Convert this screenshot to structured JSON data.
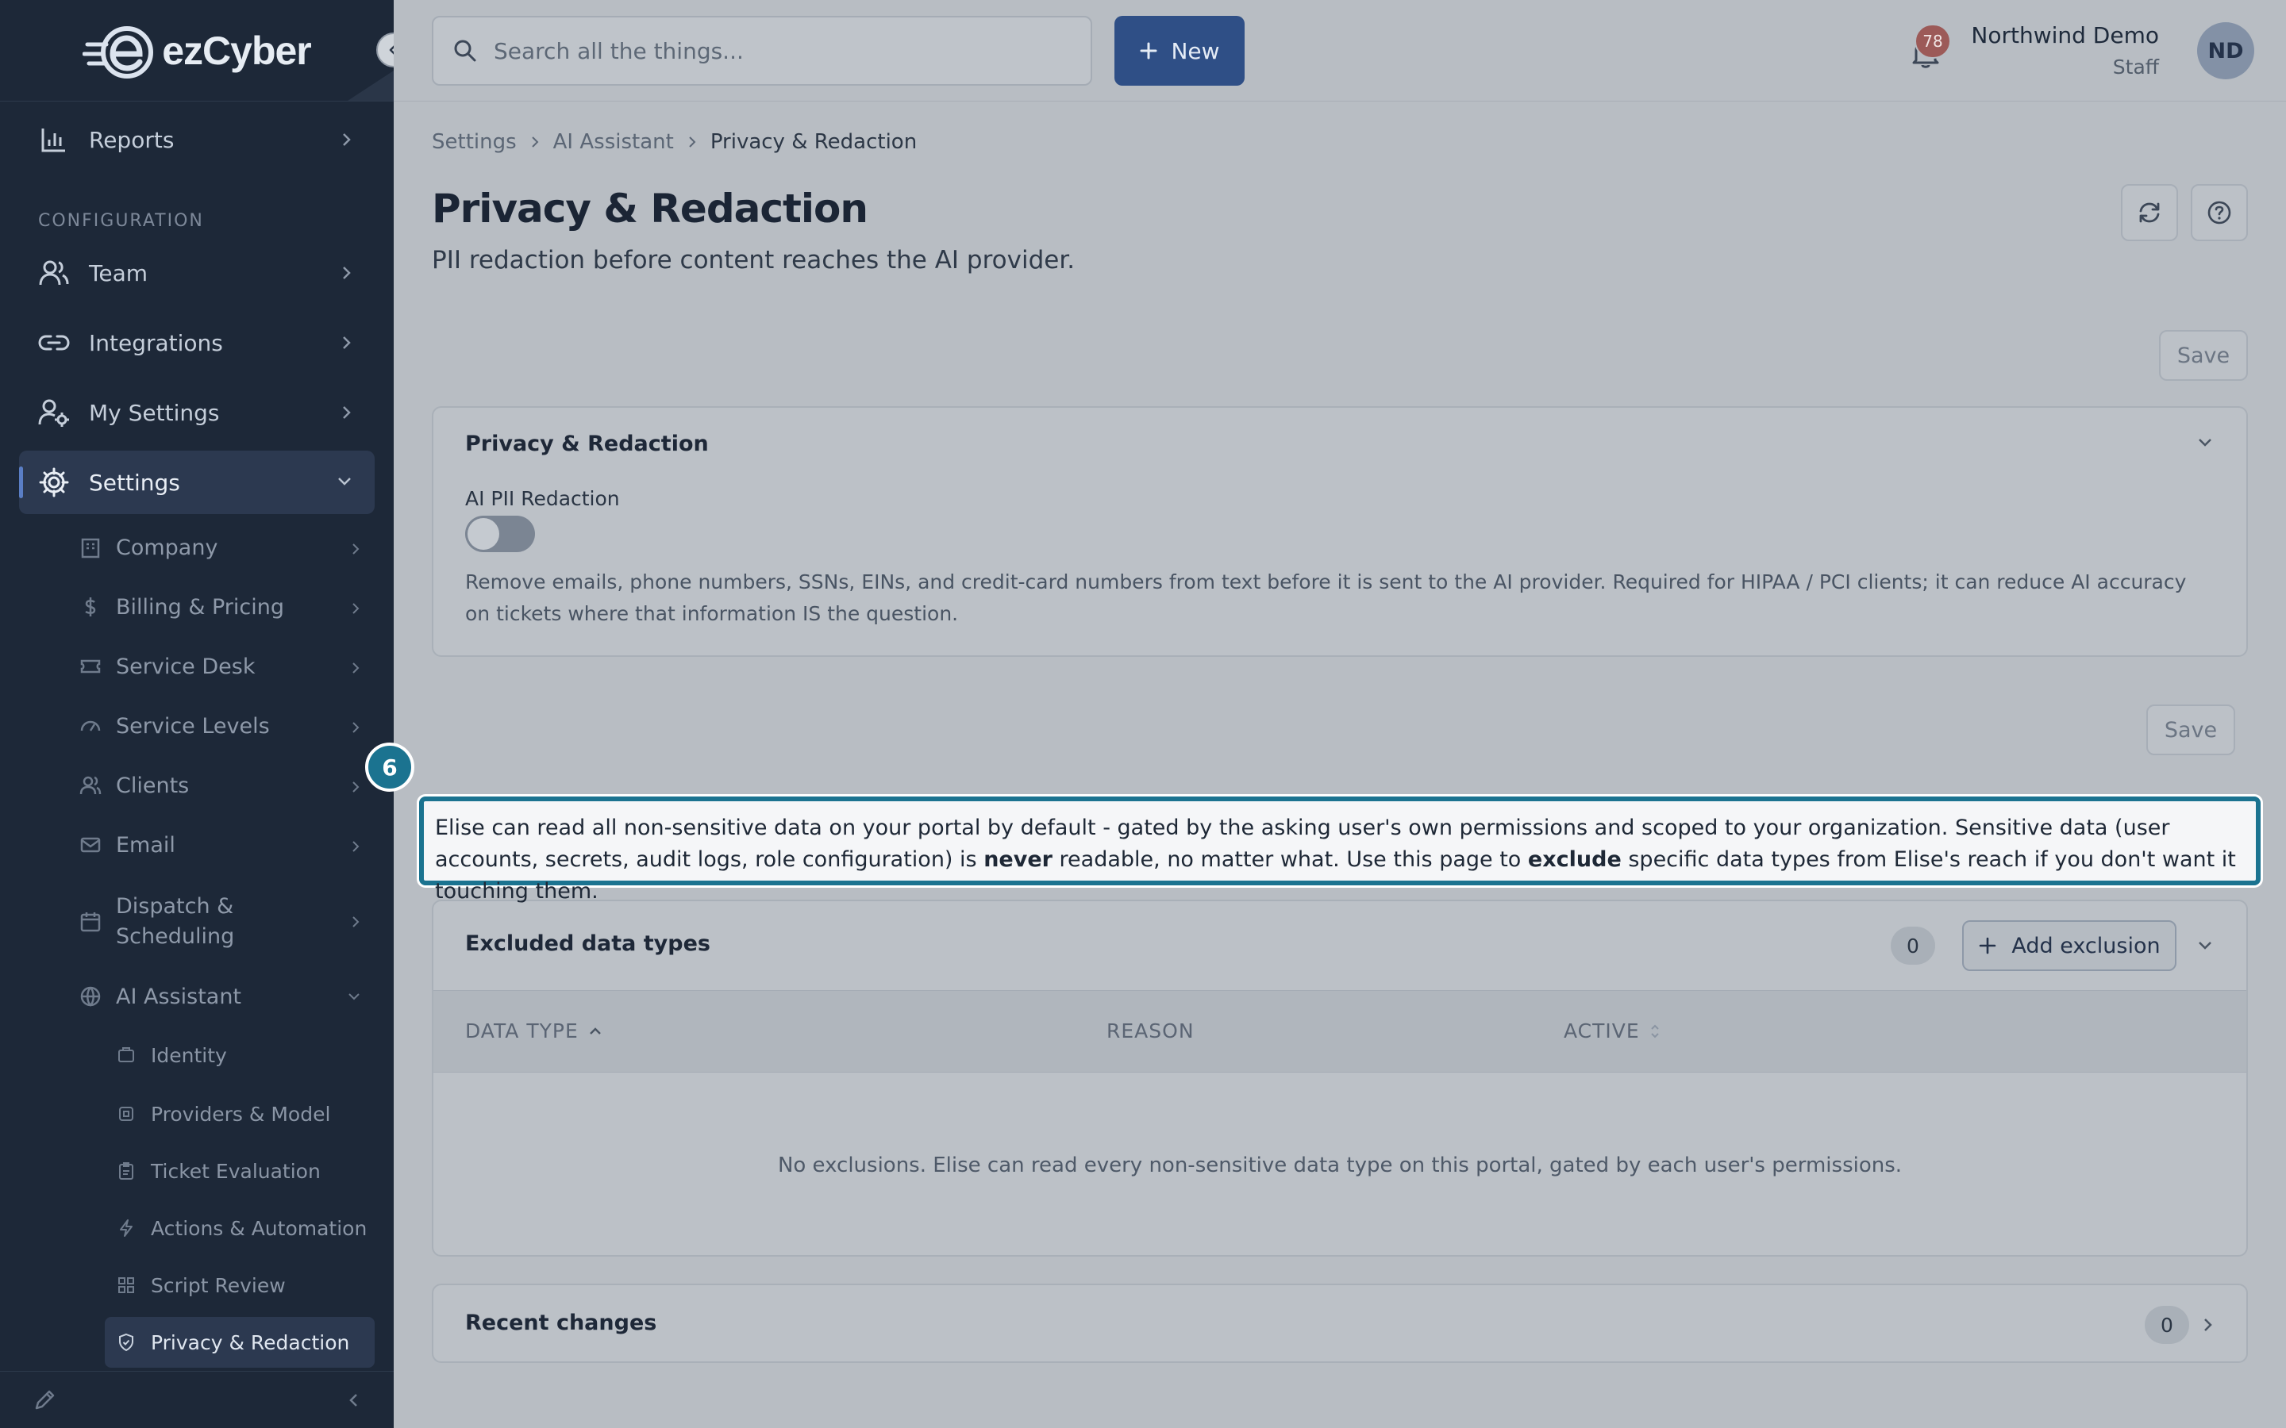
{
  "brand": {
    "name": "ezCyber"
  },
  "sidebar": {
    "top_items": [
      {
        "label": "Reports",
        "icon": "bar-chart-icon"
      }
    ],
    "section_label": "CONFIGURATION",
    "config_items": [
      {
        "label": "Team",
        "icon": "users-icon"
      },
      {
        "label": "Integrations",
        "icon": "link-icon"
      },
      {
        "label": "My Settings",
        "icon": "user-cog-icon"
      },
      {
        "label": "Settings",
        "icon": "gear-icon",
        "active": true
      }
    ],
    "settings_children": [
      {
        "label": "Company",
        "icon": "building-icon"
      },
      {
        "label": "Billing & Pricing",
        "icon": "dollar-icon"
      },
      {
        "label": "Service Desk",
        "icon": "ticket-icon"
      },
      {
        "label": "Service Levels",
        "icon": "gauge-icon"
      },
      {
        "label": "Clients",
        "icon": "clients-icon"
      },
      {
        "label": "Email",
        "icon": "mail-icon"
      },
      {
        "label": "Dispatch & Scheduling",
        "icon": "calendar-icon"
      },
      {
        "label": "AI Assistant",
        "icon": "globe-icon"
      }
    ],
    "ai_children": [
      {
        "label": "Identity",
        "icon": "id-icon"
      },
      {
        "label": "Providers & Model",
        "icon": "chip-icon"
      },
      {
        "label": "Ticket Evaluation",
        "icon": "clipboard-icon"
      },
      {
        "label": "Actions & Automation",
        "icon": "bolt-icon"
      },
      {
        "label": "Script Review",
        "icon": "grid-icon"
      },
      {
        "label": "Privacy & Redaction",
        "icon": "shield-icon",
        "active": true
      }
    ]
  },
  "topbar": {
    "search_placeholder": "Search all the things...",
    "new_label": "New",
    "notification_count": "78",
    "user_name": "Northwind Demo",
    "user_role": "Staff",
    "avatar_initials": "ND"
  },
  "breadcrumb": [
    "Settings",
    "AI Assistant",
    "Privacy & Redaction"
  ],
  "page": {
    "title": "Privacy & Redaction",
    "subtitle": "PII redaction before content reaches the AI provider.",
    "save_label": "Save"
  },
  "privacy_card": {
    "title": "Privacy & Redaction",
    "field_label": "AI PII Redaction",
    "toggle_on": false,
    "description": "Remove emails, phone numbers, SSNs, EINs, and credit-card numbers from text before it is sent to the AI provider. Required for HIPAA / PCI clients; it can reduce AI accuracy on tickets where that information IS the question."
  },
  "callout": {
    "step": "6",
    "part1": "Elise can read all non-sensitive data on your portal by default - gated by the asking user's own permissions and scoped to your organization. Sensitive data (user accounts, secrets, audit logs, role configuration) is ",
    "bold1": "never",
    "part2": " readable, no matter what. Use this page to ",
    "bold2": "exclude",
    "part3": " specific data types from Elise's reach if you don't want it touching them."
  },
  "exclusions": {
    "title": "Excluded data types",
    "count": "0",
    "add_label": "Add exclusion",
    "columns": [
      "DATA TYPE",
      "REASON",
      "ACTIVE"
    ],
    "empty_message": "No exclusions. Elise can read every non-sensitive data type on this portal, gated by each user's permissions."
  },
  "recent_changes": {
    "title": "Recent changes",
    "count": "0"
  },
  "colors": {
    "sidebar_bg": "#1d2838",
    "accent": "#2f4f86",
    "callout_border": "#1b7390"
  }
}
